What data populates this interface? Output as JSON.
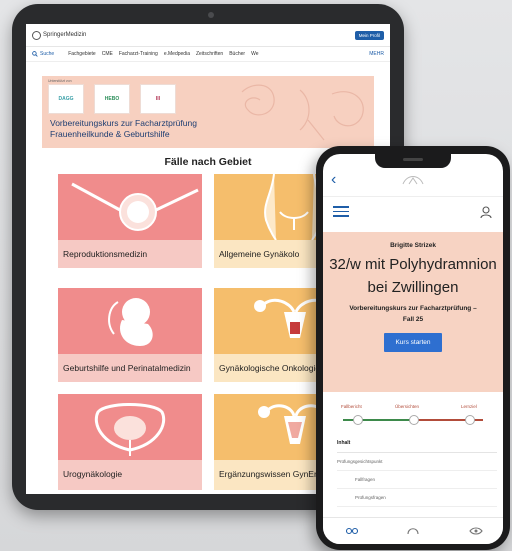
{
  "tablet": {
    "header": {
      "logo_text": "SpringerMedizin",
      "profile_button": "Mein Profil"
    },
    "nav": {
      "search_label": "Suche",
      "items": [
        "Fachgebiete",
        "CME",
        "Facharzt-Training",
        "e.Medpedia",
        "Zeitschriften",
        "Bücher",
        "We"
      ],
      "right_label": "MEHR"
    },
    "hero": {
      "partner_label": "Unterstützt von",
      "partner_logos": [
        "DAGG",
        "HEBO",
        "III"
      ],
      "title_line1": "Vorbereitungskurs zur Facharztprüfung",
      "title_line2": "Frauenheilkunde & Geburtshilfe"
    },
    "section_title": "Fälle nach Gebiet",
    "cards": [
      {
        "label": "Reproduktionsmedizin",
        "icon": "ivf-egg-needle-icon",
        "color": "#f08c8c"
      },
      {
        "label": "Allgemeine Gynäkolo",
        "icon": "female-torso-icon",
        "color": "#f5be6c"
      },
      {
        "label": "Geburtshilfe und Perinatalmedizin",
        "icon": "fetus-icon",
        "color": "#f08c8c"
      },
      {
        "label": "Gynäkologische Onkologie",
        "icon": "uterus-tumor-icon",
        "color": "#f5be6c"
      },
      {
        "label": "Urogynäkologie",
        "icon": "pelvis-bladder-icon",
        "color": "#f08c8c"
      },
      {
        "label": "Ergänzungswissen GynEndo",
        "icon": "uterus-endometrium-icon",
        "color": "#f5be6c"
      }
    ]
  },
  "phone": {
    "back_icon": "chevron-left-icon",
    "author": "Brigitte Strizek",
    "case_title": "32/w mit Polyhydramnion bei Zwillingen",
    "course_line1": "Vorbereitungskurs zur Facharztprüfung –",
    "course_line2": "Fall 25",
    "start_button": "Kurs starten",
    "progress_steps": [
      "Fallbericht",
      "Übersichten",
      "Lernziel"
    ],
    "toc_heading": "Inhalt",
    "toc_items": [
      {
        "label": "Prüfungsgesichtspunkt",
        "sub": false
      },
      {
        "label": "Fallfragen",
        "sub": true
      },
      {
        "label": "Prüfungsfragen",
        "sub": true
      }
    ],
    "colors": {
      "accent": "#2e6fd0",
      "hero_bg": "#f7d3c3",
      "step_red": "#b24c3a",
      "step_green": "#3d8a4b"
    }
  }
}
